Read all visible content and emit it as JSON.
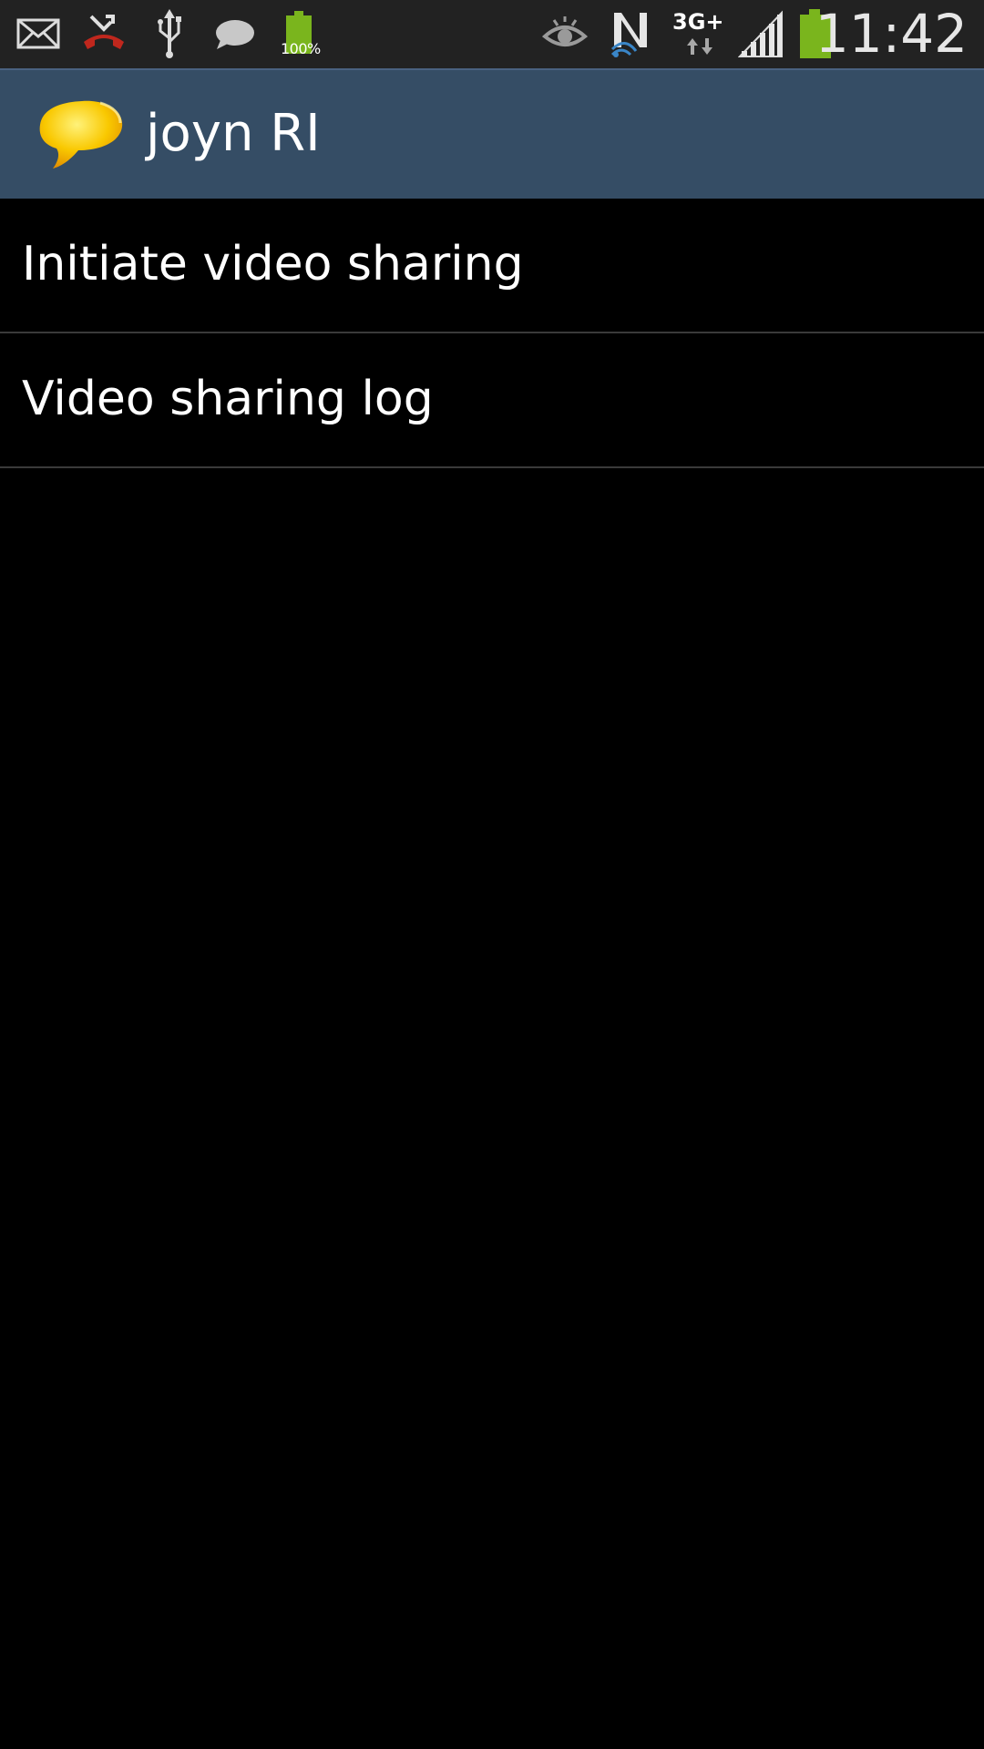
{
  "status_bar": {
    "icons_left": [
      "mail-icon",
      "missed-call-icon",
      "usb-icon",
      "chat-bubble-icon",
      "battery-small-icon"
    ],
    "battery_small_label": "100%",
    "icons_right": [
      "eye-icon",
      "nfc-icon",
      "network-3g-icon",
      "signal-icon",
      "battery-icon"
    ],
    "network_label": "3G+",
    "clock": "11:42",
    "colors": {
      "background": "#222222",
      "battery": "#7ab51d",
      "missed_call": "#c0271d",
      "nfc_accent": "#3a86c8"
    }
  },
  "action_bar": {
    "title": "joyn RI",
    "logo": "joyn-logo-icon",
    "background": "#354d65",
    "logo_color": "#f5b400"
  },
  "menu": {
    "items": [
      {
        "label": "Initiate video sharing"
      },
      {
        "label": "Video sharing log"
      }
    ]
  }
}
